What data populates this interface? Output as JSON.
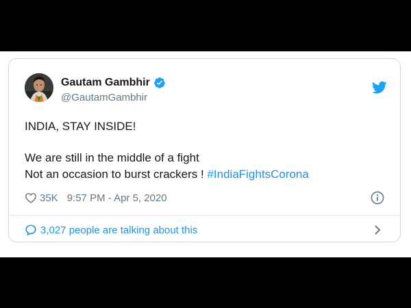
{
  "tweet": {
    "author": {
      "display_name": "Gautam Gambhir",
      "handle": "@GautamGambhir",
      "verified": true
    },
    "text": {
      "line1": "INDIA, STAY INSIDE!",
      "line2": "We are still in the middle of a fight",
      "line3": "Not an occasion to burst crackers ! ",
      "hashtag": "#IndiaFightsCorona"
    },
    "likes": "35K",
    "timestamp": "9:57 PM - Apr 5, 2020",
    "talking": "3,027 people are talking about this"
  },
  "icons": {
    "brand": "twitter-bird-icon",
    "verified": "verified-badge-icon",
    "like": "heart-icon",
    "info": "info-icon",
    "conversation": "speech-bubble-icon",
    "chevron": "chevron-right-icon"
  },
  "colors": {
    "brand_blue": "#1da1f2",
    "link_blue": "#1b95e0",
    "text_primary": "#14171a",
    "text_secondary": "#657786",
    "border": "#cfd9de"
  }
}
